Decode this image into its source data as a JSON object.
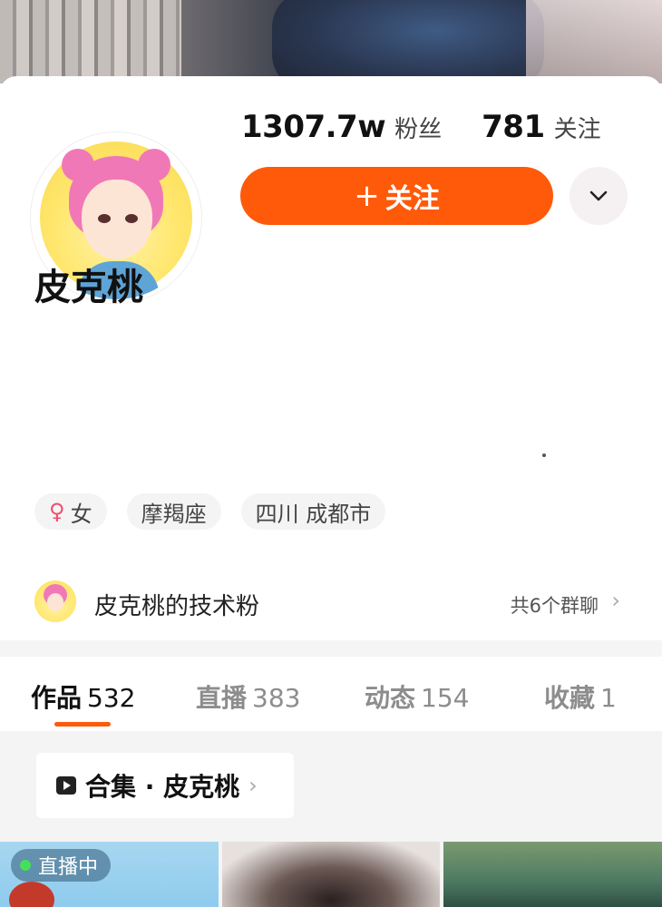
{
  "profile": {
    "followers_count": "1307.7w",
    "followers_label": "粉丝",
    "following_count": "781",
    "following_label": "关注",
    "follow_button_plus": "+",
    "follow_button_label": "关注",
    "more_icon": "chevron-down-icon",
    "nickname": "皮克桃",
    "tags": {
      "gender_symbol": "♀",
      "gender": "女",
      "zodiac": "摩羯座",
      "location": "四川 成都市"
    }
  },
  "group_chat": {
    "name": "皮克桃的技术粉",
    "count_text": "共6个群聊",
    "chevron": "›"
  },
  "tabs": [
    {
      "label": "作品",
      "count": "532"
    },
    {
      "label": "直播",
      "count": "383"
    },
    {
      "label": "动态",
      "count": "154"
    },
    {
      "label": "收藏",
      "count": "1"
    }
  ],
  "collection": {
    "title": "合集 · 皮克桃",
    "chevron": "›"
  },
  "thumbnails": [
    {
      "badge": "直播中"
    },
    {
      "badge": ""
    },
    {
      "badge": ""
    }
  ],
  "colors": {
    "accent": "#fe5a0a",
    "live_dot": "#45e05a"
  }
}
